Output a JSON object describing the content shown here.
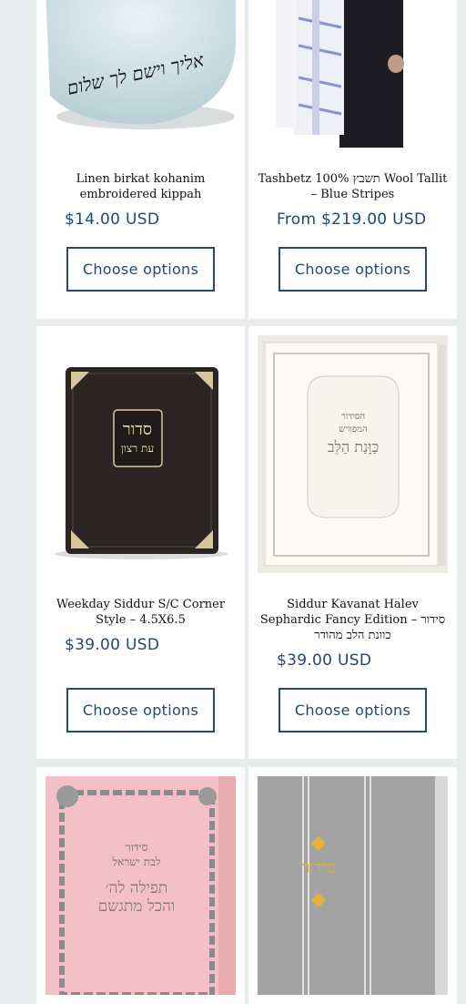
{
  "products": [
    {
      "title": "Linen birkat kohanim embroidered kippah",
      "price": "$14.00 USD",
      "button": "Choose options",
      "image_text": "אליך וישם לך שלום"
    },
    {
      "title": "Tashbetz 100% תשבץ Wool Tallit – Blue Stripes",
      "price": "From $219.00 USD",
      "button": "Choose options"
    },
    {
      "title": "Weekday Siddur S/C Corner Style – 4.5X6.5",
      "price": "$39.00 USD",
      "button": "Choose options",
      "image_text": [
        "סדור",
        "עת רצון"
      ]
    },
    {
      "title": "Siddur Kavanat Halev Sephardic Fancy Edition – סידור כוונת הלב מהודר",
      "price": "$39.00 USD",
      "button": "Choose options",
      "image_text": [
        "הסידור",
        "המפורש",
        "כַּוָּנַת הַלֵּב"
      ]
    },
    {
      "title": "",
      "price": "",
      "button": "",
      "image_text": [
        "סידור",
        "לבת ישראל",
        "תפילה לה׳",
        "והכל מתגשם"
      ]
    },
    {
      "title": "",
      "price": "",
      "button": "",
      "image_text": "סידור"
    }
  ],
  "colors": {
    "background": "#e8eced",
    "card": "#ffffff",
    "accent": "#27476e",
    "text": "#121212"
  }
}
